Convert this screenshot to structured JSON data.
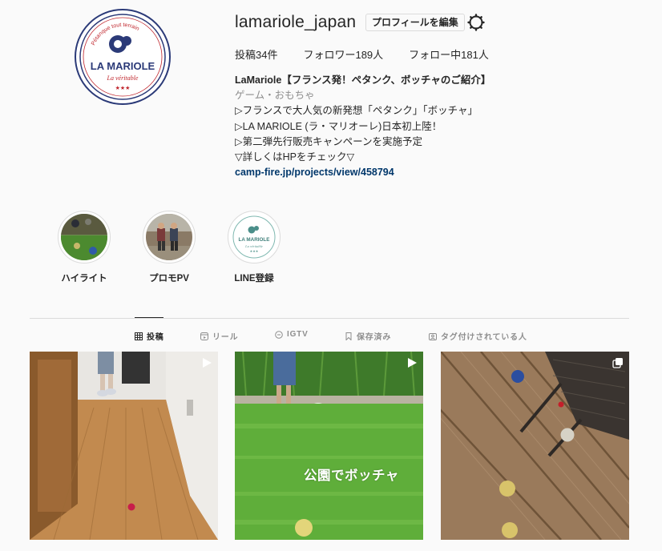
{
  "profile": {
    "username": "lamariole_japan",
    "edit_button": "プロフィールを編集",
    "settings_icon": "gear-icon",
    "avatar": {
      "brand": "LA MARIOLE",
      "tagline": "La véritable",
      "arc_text": "Pétanque tout terrain"
    }
  },
  "stats": {
    "posts": "投稿34件",
    "followers": "フォロワー189人",
    "following": "フォロー中181人"
  },
  "bio": {
    "name": "LaMariole【フランス発！ペタンク、ボッチャのご紹介】",
    "category": "ゲーム・おもちゃ",
    "lines": [
      "▷フランスで大人気の新発想「ペタンク」「ボッチャ」",
      "▷LA MARIOLE (ラ・マリオーレ)日本初上陸！",
      "▷第二弾先行販売キャンペーンを実施予定",
      "▽詳しくはHPをチェック▽"
    ],
    "link": "camp-fire.jp/projects/view/458794"
  },
  "highlights": [
    {
      "label": "ハイライト"
    },
    {
      "label": "プロモPV"
    },
    {
      "label": "LINE登録",
      "logo_text": "LA MARIOLE",
      "logo_tagline": "La véritable"
    }
  ],
  "tabs": [
    {
      "label": "投稿",
      "icon": "grid-icon",
      "active": true
    },
    {
      "label": "リール",
      "icon": "reels-icon",
      "active": false
    },
    {
      "label": "IGTV",
      "icon": "igtv-icon",
      "active": false
    },
    {
      "label": "保存済み",
      "icon": "bookmark-icon",
      "active": false
    },
    {
      "label": "タグ付けされている人",
      "icon": "tagged-icon",
      "active": false
    }
  ],
  "posts": [
    {
      "type": "video",
      "badge_icon": "play-icon"
    },
    {
      "type": "video",
      "badge_icon": "play-icon",
      "overlay_text": "公園でボッチャ"
    },
    {
      "type": "carousel",
      "badge_icon": "carousel-icon"
    }
  ],
  "colors": {
    "brand_navy": "#2b3a78",
    "brand_red": "#c0262d",
    "link": "#00376b",
    "muted": "#8e8e8e"
  }
}
